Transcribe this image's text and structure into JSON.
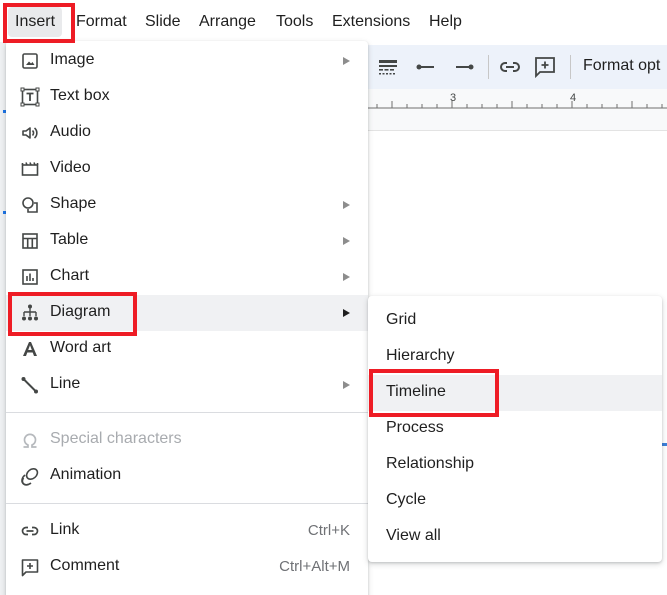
{
  "menubar": {
    "items": [
      {
        "label": "Insert",
        "active": true
      },
      {
        "label": "Format"
      },
      {
        "label": "Slide"
      },
      {
        "label": "Arrange"
      },
      {
        "label": "Tools"
      },
      {
        "label": "Extensions"
      },
      {
        "label": "Help"
      }
    ]
  },
  "toolbar": {
    "icons": [
      "line-dash-icon",
      "line-start-icon",
      "line-end-icon",
      "insert-link-icon",
      "add-comment-icon"
    ],
    "format_options_label": "Format opt"
  },
  "ruler": {
    "labels": [
      "3",
      "4"
    ]
  },
  "insert_menu": {
    "items": [
      {
        "label": "Image",
        "icon": "image-icon",
        "submenu": true
      },
      {
        "label": "Text box",
        "icon": "text-box-icon"
      },
      {
        "label": "Audio",
        "icon": "audio-icon"
      },
      {
        "label": "Video",
        "icon": "video-icon"
      },
      {
        "label": "Shape",
        "icon": "shape-icon",
        "submenu": true
      },
      {
        "label": "Table",
        "icon": "table-icon",
        "submenu": true
      },
      {
        "label": "Chart",
        "icon": "chart-icon",
        "submenu": true
      },
      {
        "label": "Diagram",
        "icon": "diagram-icon",
        "submenu": true,
        "highlighted": true
      },
      {
        "label": "Word art",
        "icon": "word-art-icon"
      },
      {
        "label": "Line",
        "icon": "line-icon",
        "submenu": true
      },
      {
        "label": "Special characters",
        "icon": "omega-icon",
        "disabled": true
      },
      {
        "label": "Animation",
        "icon": "animation-icon"
      },
      {
        "label": "Link",
        "icon": "link-icon",
        "shortcut": "Ctrl+K"
      },
      {
        "label": "Comment",
        "icon": "comment-icon",
        "shortcut": "Ctrl+Alt+M"
      }
    ]
  },
  "diagram_submenu": {
    "items": [
      {
        "label": "Grid"
      },
      {
        "label": "Hierarchy"
      },
      {
        "label": "Timeline",
        "highlighted": true
      },
      {
        "label": "Process"
      },
      {
        "label": "Relationship"
      },
      {
        "label": "Cycle"
      },
      {
        "label": "View all"
      }
    ]
  },
  "colors": {
    "highlight_box": "#ee1c25",
    "menu_hover": "#f0f1f3",
    "toolbar_bg": "#edf2fa"
  }
}
